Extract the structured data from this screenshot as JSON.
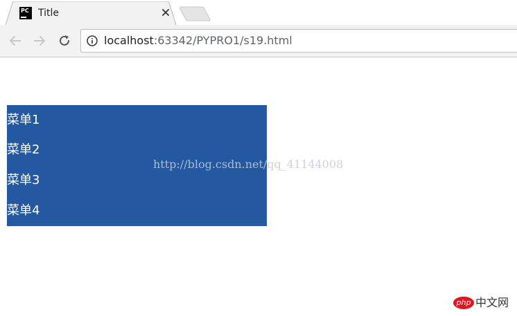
{
  "browser": {
    "tab": {
      "favicon_text": "PC",
      "title": "Title",
      "close_glyph": "×"
    },
    "nav": {
      "back_icon": "arrow-left-icon",
      "forward_icon": "arrow-right-icon",
      "reload_icon": "reload-icon"
    },
    "address": {
      "host": "localhost",
      "path": ":63342/PYPRO1/s19.html",
      "security_icon": "info-icon"
    }
  },
  "page": {
    "menu_items": [
      "菜单1",
      "菜单2",
      "菜单3",
      "菜单4"
    ],
    "watermark": "http://blog.csdn.net/qq_41144008",
    "menu_color": "#2459a2"
  },
  "footer_logo": {
    "badge": "php",
    "text": "中文网"
  }
}
